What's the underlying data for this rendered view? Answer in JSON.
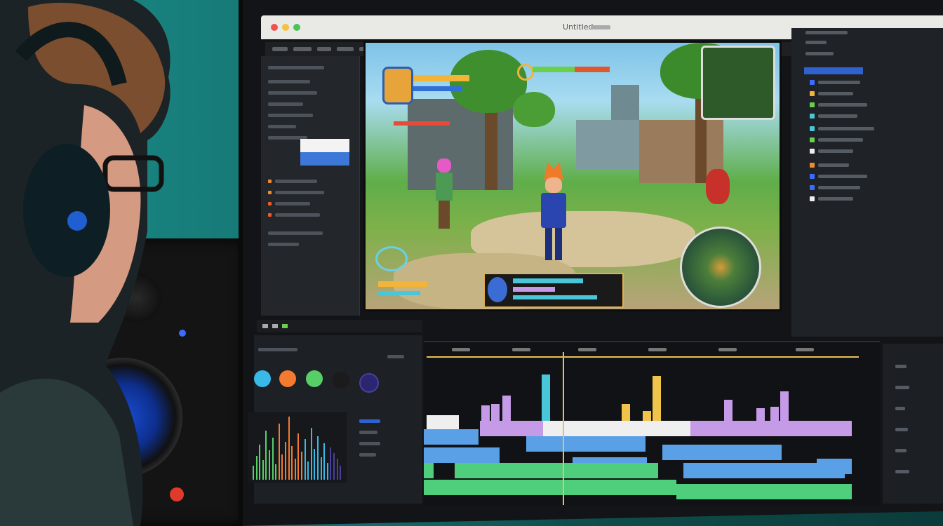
{
  "scene": {
    "description_free": true
  },
  "window": {
    "title": "Untitled"
  },
  "colors": {
    "swatches": [
      "#39b9e7",
      "#f37a2e",
      "#56d066",
      "#1b1b1b",
      "#4a3f9e"
    ],
    "track_purple": "#c59be8",
    "track_blue": "#5aa0e6",
    "track_green": "#4fcf7c",
    "track_cyan": "#49c7d9",
    "track_yellow": "#f0c44a",
    "track_white": "#efefef",
    "accent": "#e6c15a"
  },
  "icons": [
    "headphones-icon",
    "gear-icon",
    "play-icon",
    "minimap-icon"
  ]
}
